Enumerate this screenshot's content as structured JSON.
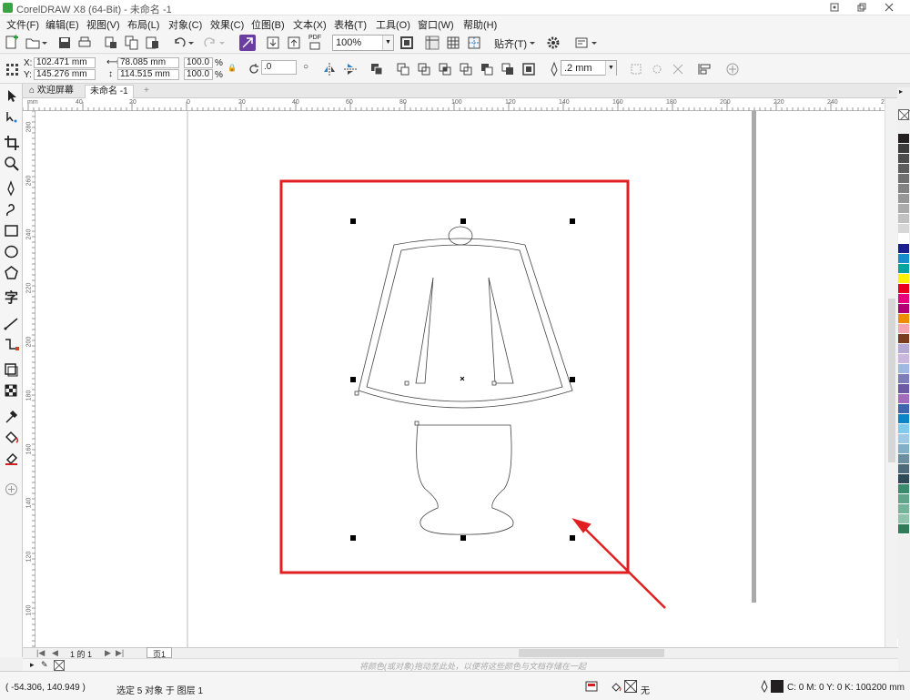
{
  "window": {
    "title": "CorelDRAW X8 (64-Bit) - 未命名 -1",
    "controls": [
      "minimize",
      "restore",
      "close"
    ]
  },
  "menu": [
    "文件(F)",
    "编辑(E)",
    "视图(V)",
    "布局(L)",
    "对象(C)",
    "效果(C)",
    "位图(B)",
    "文本(X)",
    "表格(T)",
    "工具(O)",
    "窗口(W)",
    "帮助(H)"
  ],
  "toolbar": {
    "zoom_value": "100%",
    "snap_label": "贴齐(T)",
    "pdf_label": "PDF"
  },
  "property_bar": {
    "x_label": "X:",
    "x_value": "102.471 mm",
    "y_label": "Y:",
    "y_value": "145.276 mm",
    "width_value": "78.085 mm",
    "height_value": "114.515 mm",
    "scale_w": "100.0",
    "scale_h": "100.0",
    "percent": "%",
    "rotation": ".0",
    "outline_width": ".2 mm"
  },
  "tabs": {
    "welcome": "欢迎屏幕",
    "document": "未命名 -1",
    "add": "+"
  },
  "ruler": {
    "h_labels": [
      "40",
      "20",
      "0",
      "20",
      "40",
      "60",
      "80",
      "100",
      "120",
      "140",
      "160",
      "180",
      "200",
      "220",
      "240",
      "260",
      "280"
    ],
    "v_labels": [
      "280",
      "260",
      "240",
      "220",
      "200",
      "180",
      "160",
      "140",
      "120",
      "100",
      "80"
    ]
  },
  "page_nav": {
    "page_count": "1 的 1",
    "page_tab": "页1"
  },
  "hint_text": "将颜色(或对象)拖动至此处，以便将这些颜色与文档存储在一起",
  "status": {
    "coords": "( -54.306, 140.949 )",
    "selection": "选定 5 对象 于 图层 1",
    "fill_none": "无",
    "outline_color": "C: 0 M: 0 Y: 0 K: 100",
    "outline_width": ".200 mm"
  },
  "colors": {
    "highlight_frame": "#e02020",
    "arrow": "#e02020",
    "palette": [
      "#231f20",
      "#3c3c3c",
      "#4d4d4d",
      "#5e5e5e",
      "#717171",
      "#838383",
      "#979797",
      "#ababab",
      "#c1c1c1",
      "#d7d7d7",
      "#ffffff",
      "#1a1f8f",
      "#1b8bd0",
      "#00a5a0",
      "#fff100",
      "#e8001c",
      "#e6007e",
      "#b10077",
      "#f08c00",
      "#f6a4b0",
      "#7b3d1c",
      "#b4a8d4",
      "#cbb6de",
      "#9db9e1",
      "#7d7dbb",
      "#6d5aa7",
      "#a46abd",
      "#3d66b0",
      "#0e84c8",
      "#7ecbee",
      "#9ec9e6",
      "#7fb0c8",
      "#6a8fa0",
      "#4c6a78",
      "#2d4a56",
      "#3a8c6e",
      "#5ea58b",
      "#72b59a",
      "#8fc3ab",
      "#2e7d58"
    ]
  }
}
